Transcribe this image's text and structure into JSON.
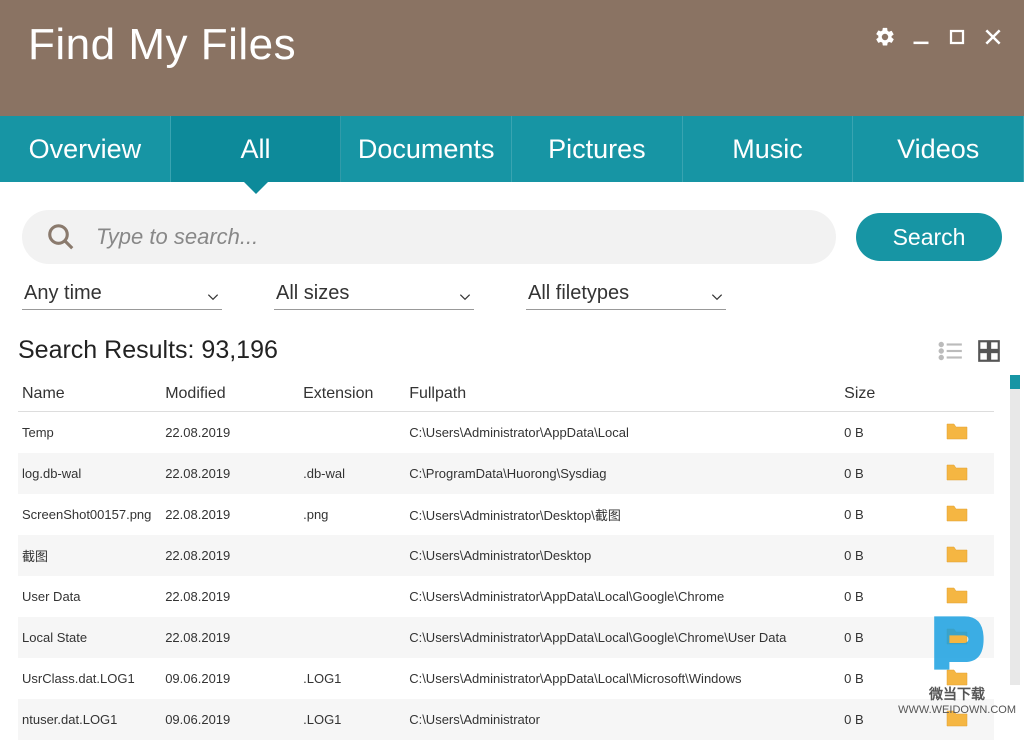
{
  "app": {
    "title": "Find My Files"
  },
  "tabs": [
    {
      "label": "Overview",
      "active": false
    },
    {
      "label": "All",
      "active": true
    },
    {
      "label": "Documents",
      "active": false
    },
    {
      "label": "Pictures",
      "active": false
    },
    {
      "label": "Music",
      "active": false
    },
    {
      "label": "Videos",
      "active": false
    }
  ],
  "search": {
    "placeholder": "Type to search...",
    "value": "",
    "button": "Search"
  },
  "filters": {
    "time": "Any time",
    "size": "All sizes",
    "filetype": "All filetypes"
  },
  "results": {
    "label": "Search Results: ",
    "count": "93,196"
  },
  "columns": {
    "name": "Name",
    "modified": "Modified",
    "extension": "Extension",
    "fullpath": "Fullpath",
    "size": "Size"
  },
  "rows": [
    {
      "name": "Temp",
      "modified": "22.08.2019",
      "extension": "",
      "fullpath": "C:\\Users\\Administrator\\AppData\\Local",
      "size": "0 B"
    },
    {
      "name": "log.db-wal",
      "modified": "22.08.2019",
      "extension": ".db-wal",
      "fullpath": "C:\\ProgramData\\Huorong\\Sysdiag",
      "size": "0 B"
    },
    {
      "name": "ScreenShot00157.png",
      "modified": "22.08.2019",
      "extension": ".png",
      "fullpath": "C:\\Users\\Administrator\\Desktop\\截图",
      "size": "0 B"
    },
    {
      "name": "截图",
      "modified": "22.08.2019",
      "extension": "",
      "fullpath": "C:\\Users\\Administrator\\Desktop",
      "size": "0 B"
    },
    {
      "name": "User Data",
      "modified": "22.08.2019",
      "extension": "",
      "fullpath": "C:\\Users\\Administrator\\AppData\\Local\\Google\\Chrome",
      "size": "0 B"
    },
    {
      "name": "Local State",
      "modified": "22.08.2019",
      "extension": "",
      "fullpath": "C:\\Users\\Administrator\\AppData\\Local\\Google\\Chrome\\User Data",
      "size": "0 B"
    },
    {
      "name": "UsrClass.dat.LOG1",
      "modified": "09.06.2019",
      "extension": ".LOG1",
      "fullpath": "C:\\Users\\Administrator\\AppData\\Local\\Microsoft\\Windows",
      "size": "0 B"
    },
    {
      "name": "ntuser.dat.LOG1",
      "modified": "09.06.2019",
      "extension": ".LOG1",
      "fullpath": "C:\\Users\\Administrator",
      "size": "0 B"
    }
  ],
  "watermark": {
    "line1": "微当下载",
    "line2": "WWW.WEIDOWN.COM"
  }
}
